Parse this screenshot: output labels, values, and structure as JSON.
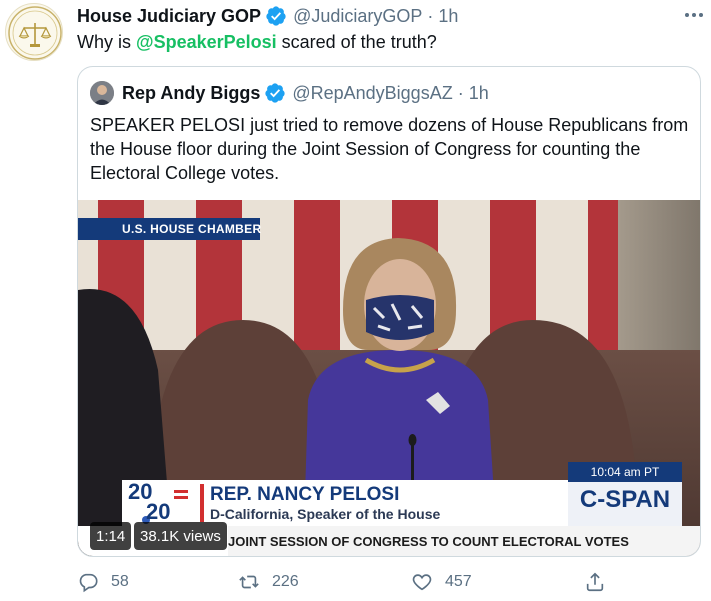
{
  "tweet": {
    "author_name": "House Judiciary GOP",
    "author_handle": "@JudiciaryGOP",
    "time": "1h",
    "separator": "·",
    "text_before": "Why is ",
    "mention": "@SpeakerPelosi",
    "text_after": " scared of the truth?",
    "avatar_mark": "1813"
  },
  "quoted": {
    "author_name": "Rep Andy Biggs",
    "author_handle": "@RepAndyBiggsAZ",
    "time": "1h",
    "separator": "·",
    "text": "SPEAKER PELOSI just tried to remove dozens of House Republicans from the House floor during the Joint Session of Congress for counting the Electoral College votes."
  },
  "video": {
    "location_label": "U.S. HOUSE CHAMBER",
    "time_of_day": "10:04 am PT",
    "lower_third_name": "REP. NANCY PELOSI",
    "lower_third_title": "D-California, Speaker of the House",
    "ticker": "JOINT SESSION OF CONGRESS TO COUNT ELECTORAL VOTES",
    "network": "C-SPAN",
    "logo_year_top": "20",
    "logo_year_bottom": "20",
    "duration": "1:14",
    "views": "38.1K views"
  },
  "actions": {
    "replies": "58",
    "retweets": "226",
    "likes": "457"
  },
  "colors": {
    "accent": "#1da1f2",
    "mention": "#17bf63",
    "muted": "#5b7083",
    "border": "#cfd9de"
  },
  "icons": [
    "verified-badge-icon",
    "more-icon",
    "reply-icon",
    "retweet-icon",
    "like-icon",
    "share-icon"
  ]
}
